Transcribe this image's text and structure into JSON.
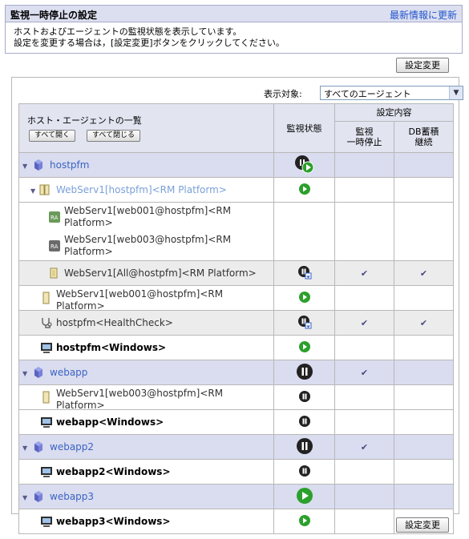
{
  "header": {
    "title": "監視一時停止の設定",
    "refresh_link": "最新情報に更新"
  },
  "description": {
    "line1": "ホストおよびエージェントの監視状態を表示しています。",
    "line2": "設定を変更する場合は，[設定変更]ボタンをクリックしてください。"
  },
  "buttons": {
    "change_settings": "設定変更",
    "expand_all": "すべて開く",
    "collapse_all": "すべて閉じる"
  },
  "filter": {
    "label": "表示対象:",
    "selected": "すべてのエージェント"
  },
  "table": {
    "col_list": "ホスト・エージェントの一覧",
    "col_status": "監視状態",
    "col_settings": "設定内容",
    "col_suspend": "監視\n一時停止",
    "col_db": "DB蓄積\n継続",
    "check_mark": "✔",
    "rows": [
      {
        "name": "hostpfm",
        "status": "pause-play",
        "suspend": "",
        "db": ""
      },
      {
        "name": "WebServ1[hostpfm]<RM Platform>",
        "status": "play",
        "suspend": "",
        "db": ""
      },
      {
        "name": "WebServ1[web001@hostpfm]<RM Platform>",
        "status": "",
        "suspend": "",
        "db": ""
      },
      {
        "name": "WebServ1[web003@hostpfm]<RM Platform>",
        "status": "",
        "suspend": "",
        "db": ""
      },
      {
        "name": "WebServ1[All@hostpfm]<RM Platform>",
        "status": "pause-mixed",
        "suspend": "✔",
        "db": "✔"
      },
      {
        "name": "WebServ1[web001@hostpfm]<RM Platform>",
        "status": "play",
        "suspend": "",
        "db": ""
      },
      {
        "name": "hostpfm<HealthCheck>",
        "status": "pause-mixed",
        "suspend": "✔",
        "db": "✔"
      },
      {
        "name": "hostpfm<Windows>",
        "status": "play",
        "suspend": "",
        "db": ""
      },
      {
        "name": "webapp",
        "status": "pause",
        "suspend": "✔",
        "db": ""
      },
      {
        "name": "WebServ1[web003@hostpfm]<RM Platform>",
        "status": "pause",
        "suspend": "",
        "db": ""
      },
      {
        "name": "webapp<Windows>",
        "status": "pause",
        "suspend": "",
        "db": ""
      },
      {
        "name": "webapp2",
        "status": "pause",
        "suspend": "✔",
        "db": ""
      },
      {
        "name": "webapp2<Windows>",
        "status": "pause",
        "suspend": "",
        "db": ""
      },
      {
        "name": "webapp3",
        "status": "play",
        "suspend": "",
        "db": ""
      },
      {
        "name": "webapp3<Windows>",
        "status": "play",
        "suspend": "",
        "db": ""
      }
    ]
  },
  "colors": {
    "header_bg": "#dcdff0",
    "group_row_bg": "#dadcef",
    "link": "#3a64c4",
    "check": "#4a4a86",
    "play_green": "#2ca02c"
  }
}
